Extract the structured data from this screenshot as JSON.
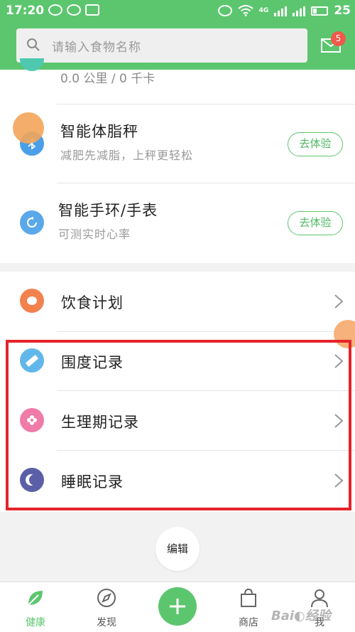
{
  "status_bar": {
    "time": "17:20",
    "battery": "25",
    "network": "4G"
  },
  "search": {
    "placeholder": "请输入食物名称"
  },
  "notifications": {
    "count": "5"
  },
  "partial_row": {
    "text": "0.0 公里 / 0 千卡"
  },
  "devices": [
    {
      "title": "智能体脂秤",
      "subtitle": "减肥先减脂，上秤更轻松",
      "button": "去体验",
      "color": "#4a9fe6"
    },
    {
      "title": "智能手环/手表",
      "subtitle": "可测实时心率",
      "button": "去体验",
      "color": "#5aa8ea"
    }
  ],
  "records": [
    {
      "label": "饮食计划",
      "color": "#f2814e"
    },
    {
      "label": "围度记录",
      "color": "#62b7ea"
    },
    {
      "label": "生理期记录",
      "color": "#f07aa8"
    },
    {
      "label": "睡眠记录",
      "color": "#5a5fa8"
    }
  ],
  "edit_button": "编辑",
  "tabs": [
    {
      "label": "健康",
      "active": true
    },
    {
      "label": "发现",
      "active": false
    },
    {
      "label": "商店",
      "active": false
    },
    {
      "label": "我",
      "active": false
    }
  ],
  "colors": {
    "brand_green": "#5cc66f",
    "highlight_red": "#e5232a"
  }
}
